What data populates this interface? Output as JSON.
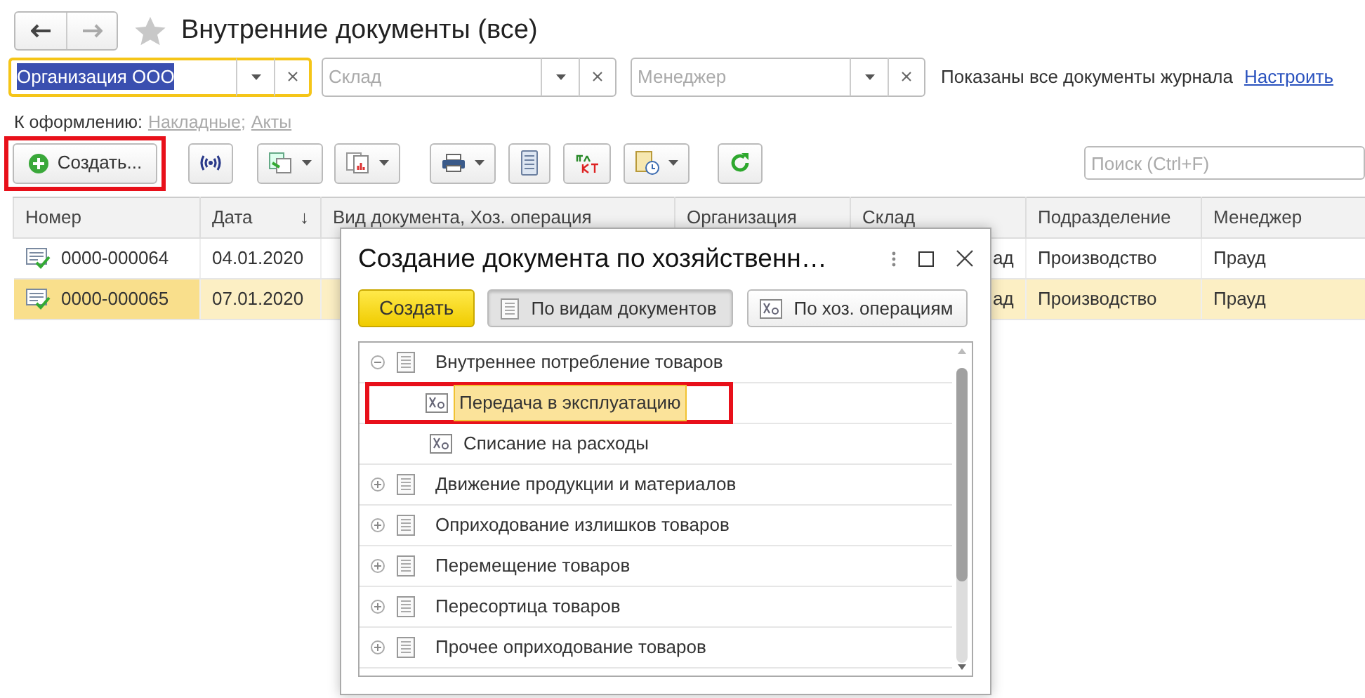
{
  "window": {
    "title": "Внутренние документы (все)",
    "favorite": false
  },
  "filters": [
    {
      "value": "Организация ООО",
      "focused": true,
      "text_selected": true
    },
    {
      "placeholder": "Склад",
      "focused": false
    },
    {
      "placeholder": "Менеджер",
      "focused": false
    }
  ],
  "filter_status": "Показаны все документы журнала",
  "settings_link": "Настроить",
  "pending": {
    "label": "К оформлению:",
    "links": [
      "Накладные",
      "Акты"
    ],
    "separator": ";"
  },
  "toolbar": {
    "create_button": "Создать...",
    "create_highlighted": true,
    "search_placeholder": "Поиск (Ctrl+F)"
  },
  "table": {
    "columns": [
      {
        "label": "Номер"
      },
      {
        "label": "Дата",
        "sort_mark": "↓"
      },
      {
        "label": "Вид документа, Хоз. операция"
      },
      {
        "label": "Организация"
      },
      {
        "label": "Склад"
      },
      {
        "label": "Подразделение"
      },
      {
        "label": "Менеджер"
      }
    ],
    "rows": [
      {
        "selected": false,
        "posted": true,
        "number": "0000-000064",
        "date": "04.01.2020",
        "warehouse": "ад",
        "department": "Производство",
        "manager": "Прауд"
      },
      {
        "selected": true,
        "posted": true,
        "number": "0000-000065",
        "date": "07.01.2020",
        "warehouse": "ад",
        "department": "Производство",
        "manager": "Прауд"
      }
    ]
  },
  "dialog": {
    "title": "Создание документа по хозяйственн…",
    "create_button": "Создать",
    "view_buttons": [
      {
        "label": "По видам документов",
        "kind": "doc",
        "selected": true
      },
      {
        "label": "По хоз. операциям",
        "kind": "operation",
        "selected": false
      }
    ],
    "tree": [
      {
        "label": "Внутреннее потребление товаров",
        "kind": "doc",
        "expanded": true,
        "children": [
          {
            "label": "Передача в эксплуатацию",
            "kind": "operation",
            "selected": true,
            "highlighted": true
          },
          {
            "label": "Списание на расходы",
            "kind": "operation",
            "selected": false,
            "highlighted": false
          }
        ]
      },
      {
        "label": "Движение продукции и материалов",
        "kind": "doc",
        "expanded": false
      },
      {
        "label": "Оприходование излишков товаров",
        "kind": "doc",
        "expanded": false
      },
      {
        "label": "Перемещение товаров",
        "kind": "doc",
        "expanded": false
      },
      {
        "label": "Пересортица товаров",
        "kind": "doc",
        "expanded": false
      },
      {
        "label": "Прочее оприходование товаров",
        "kind": "doc",
        "expanded": false
      }
    ]
  }
}
